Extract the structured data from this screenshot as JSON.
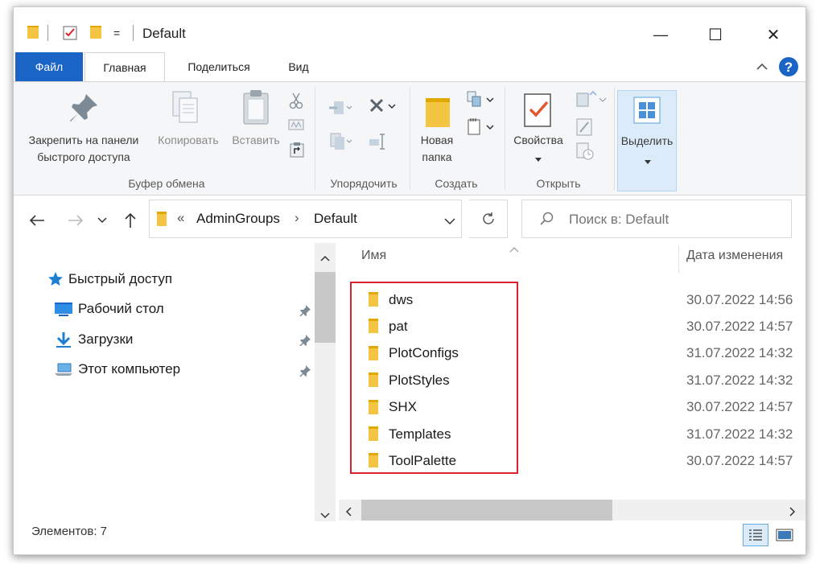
{
  "window": {
    "title": "Default",
    "controls": {
      "minimize": "—",
      "maximize": "☐",
      "close": "✕"
    },
    "qat_dropdown": "="
  },
  "tabs": [
    {
      "label": "Файл"
    },
    {
      "label": "Главная"
    },
    {
      "label": "Поделиться"
    },
    {
      "label": "Вид"
    }
  ],
  "ribbon": {
    "pin": {
      "line1": "Закрепить на панели",
      "line2": "быстрого доступа"
    },
    "copy": "Копировать",
    "paste": "Вставить",
    "clipboard_group": "Буфер обмена",
    "organize_group": "Упорядочить",
    "new_folder": {
      "line1": "Новая",
      "line2": "папка"
    },
    "create_group": "Создать",
    "properties": "Свойства",
    "open_group": "Открыть",
    "select": "Выделить"
  },
  "address": {
    "prefix": "«",
    "crumbs": [
      "AdminGroups",
      "Default"
    ],
    "separator": "›"
  },
  "search": {
    "placeholder": "Поиск в: Default"
  },
  "nav": {
    "items": [
      {
        "label": "Быстрый доступ"
      },
      {
        "label": "Рабочий стол"
      },
      {
        "label": "Загрузки"
      },
      {
        "label": "Этот компьютер"
      }
    ]
  },
  "columns": {
    "name": "Имя",
    "date": "Дата изменения"
  },
  "files": [
    {
      "name": "dws",
      "date": "30.07.2022 14:56"
    },
    {
      "name": "pat",
      "date": "30.07.2022 14:57"
    },
    {
      "name": "PlotConfigs",
      "date": "31.07.2022 14:32"
    },
    {
      "name": "PlotStyles",
      "date": "31.07.2022 14:32"
    },
    {
      "name": "SHX",
      "date": "30.07.2022 14:57"
    },
    {
      "name": "Templates",
      "date": "31.07.2022 14:32"
    },
    {
      "name": "ToolPalette",
      "date": "30.07.2022 14:57"
    }
  ],
  "status": {
    "items_count": "Элементов: 7"
  },
  "colors": {
    "accent": "#1a64c6",
    "highlight": "#d9232e",
    "folder": "#f4c542"
  }
}
